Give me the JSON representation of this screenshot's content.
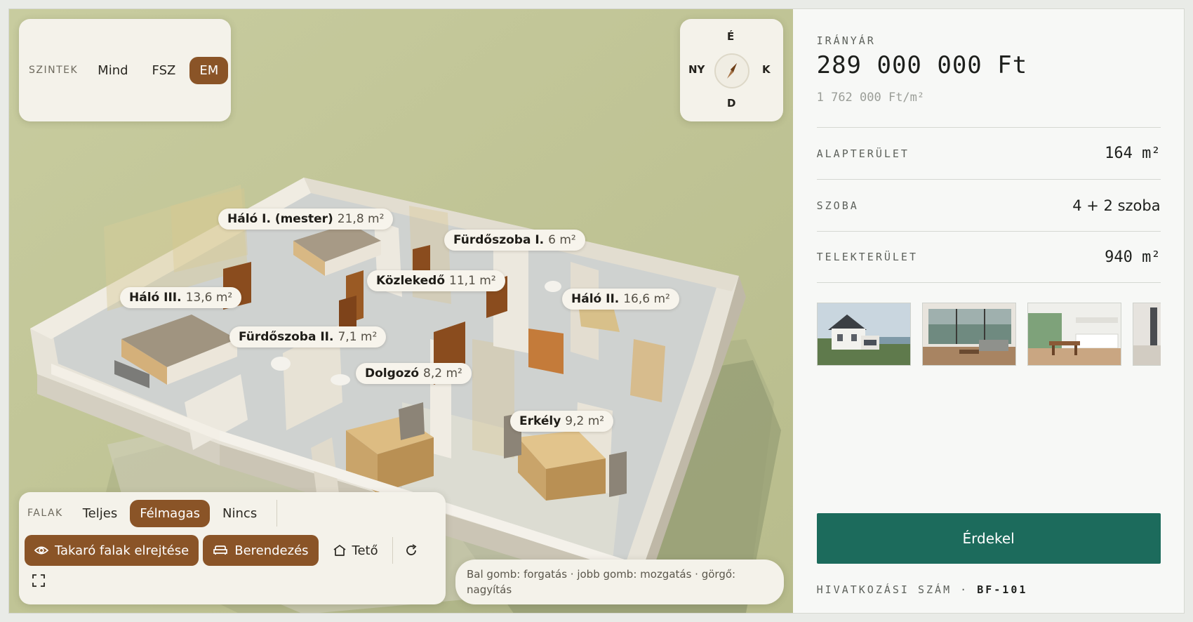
{
  "levels": {
    "label": "SZINTEK",
    "options": [
      "Mind",
      "FSZ",
      "EM"
    ],
    "active": "EM"
  },
  "compass": {
    "n": "É",
    "w": "NY",
    "e": "K",
    "s": "D"
  },
  "rooms": [
    {
      "name": "Háló I. (mester)",
      "area": "21,8 m²"
    },
    {
      "name": "Fürdőszoba I.",
      "area": "6 m²"
    },
    {
      "name": "Közlekedő",
      "area": "11,1 m²"
    },
    {
      "name": "Háló III.",
      "area": "13,6 m²"
    },
    {
      "name": "Háló II.",
      "area": "16,6 m²"
    },
    {
      "name": "Fürdőszoba II.",
      "area": "7,1 m²"
    },
    {
      "name": "Dolgozó",
      "area": "8,2 m²"
    },
    {
      "name": "Erkély",
      "area": "9,2 m²"
    }
  ],
  "walls": {
    "label": "FALAK",
    "options": [
      "Teljes",
      "Félmagas",
      "Nincs"
    ],
    "active": "Félmagas",
    "hide_walls_label": "Takaró falak elrejtése",
    "furniture_label": "Berendezés",
    "roof_label": "Tető"
  },
  "hint": "Bal gomb: forgatás · jobb gomb: mozgatás · görgő: nagyítás",
  "listing": {
    "price_label": "IRÁNYÁR",
    "price": "289 000 000 Ft",
    "price_per_m2": "1 762 000 Ft/m²",
    "stats": [
      {
        "label": "ALAPTERÜLET",
        "value": "164 m²"
      },
      {
        "label": "SZOBA",
        "value": "4 + 2 szoba"
      },
      {
        "label": "TELEKTERÜLET",
        "value": "940 m²"
      }
    ],
    "cta": "Érdekel",
    "ref_label": "HIVATKOZÁSI SZÁM ·",
    "ref_value": "BF-101"
  },
  "colors": {
    "accent": "#8a5427",
    "cta": "#1c6b5c",
    "viewer_bg": "#c2c79f"
  }
}
